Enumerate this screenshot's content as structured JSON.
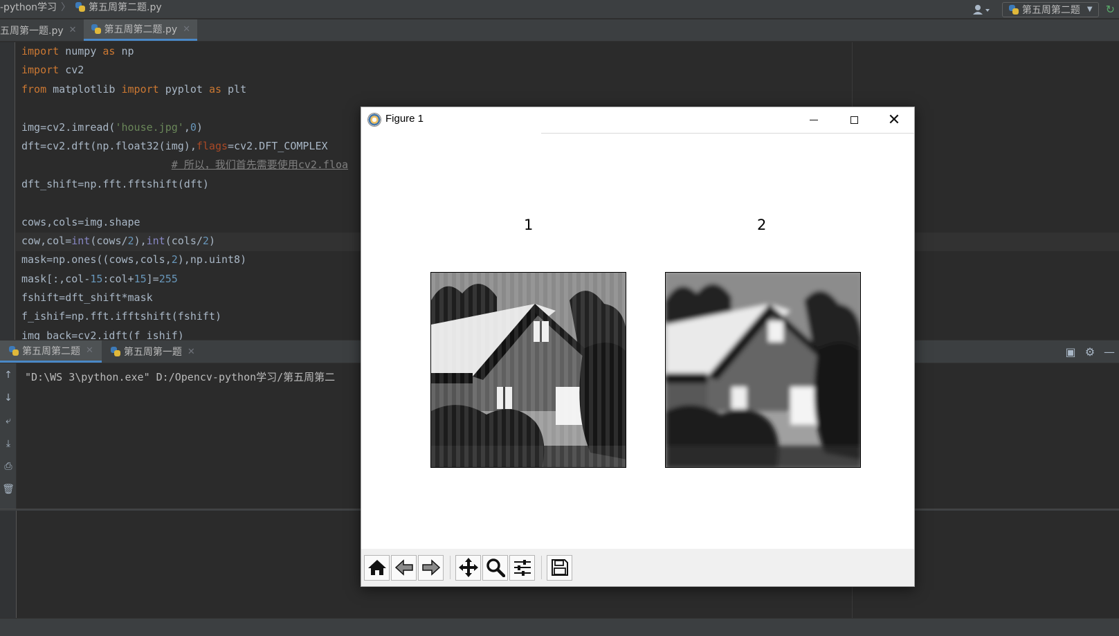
{
  "navbar": {
    "breadcrumb_project": "-python学习",
    "breadcrumb_file": "第五周第二题.py",
    "run_config": "第五周第二题"
  },
  "editor_tabs": [
    {
      "label": "五周第一题.py",
      "active": false
    },
    {
      "label": "第五周第二题.py",
      "active": true
    }
  ],
  "editor": {
    "lines": [
      "import numpy as np",
      "import cv2",
      "from matplotlib import pyplot as plt",
      "",
      "img=cv2.imread('house.jpg',0)",
      "dft=cv2.dft(np.float32(img),flags=cv2.DFT_COMPLEX",
      "                        # 所以，我们首先需要使用cv2.floa",
      "dft_shift=np.fft.fftshift(dft)",
      "",
      "cows,cols=img.shape",
      "cow,col=int(cows/2),int(cols/2)",
      "mask=np.ones((cows,cols,2),np.uint8)",
      "mask[:,col-15:col+15]=255",
      "fshift=dft_shift*mask",
      "f_ishif=np.fft.ifftshift(fshift)",
      "img_back=cv2.idft(f_ishif)"
    ]
  },
  "run_panel": {
    "tabs": [
      {
        "label": "第五周第二题",
        "active": true
      },
      {
        "label": "第五周第一题",
        "active": false
      }
    ],
    "console_text": "\"D:\\WS 3\\python.exe\" D:/Opencv-python学习/第五周第二"
  },
  "figure": {
    "window_title": "Figure 1",
    "subplots": [
      {
        "title": "1"
      },
      {
        "title": "2"
      }
    ],
    "toolbar": [
      "home-icon",
      "back-icon",
      "forward-icon",
      "pan-icon",
      "zoom-icon",
      "configure-subplots-icon",
      "save-icon"
    ]
  },
  "colors": {
    "keyword": "#cc7832",
    "string": "#6a8759",
    "number": "#6897bb",
    "param": "#aa4926",
    "builtin": "#8888c6",
    "comment": "#808080",
    "tab_accent": "#4a88c7"
  }
}
